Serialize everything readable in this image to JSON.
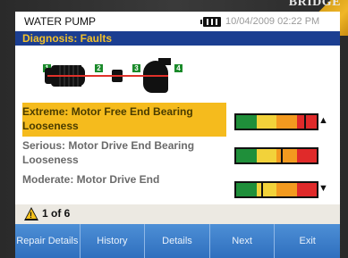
{
  "bezel": {
    "label": "BRIDGE"
  },
  "status_bar": {
    "title": "WATER PUMP",
    "datetime": "10/04/2009 02:22 PM",
    "battery_icon": "battery-icon"
  },
  "header": {
    "title": "Diagnosis: Faults"
  },
  "machine_positions": [
    "1",
    "2",
    "3",
    "4"
  ],
  "faults": [
    {
      "label": "Extreme: Motor Free End Bearing Looseness",
      "severity_marker": 0.88,
      "selected": true,
      "scroll_icon": "▲"
    },
    {
      "label": "Serious: Motor Drive End Bearing Looseness",
      "severity_marker": 0.58,
      "selected": false,
      "scroll_icon": ""
    },
    {
      "label": "Moderate: Motor Drive End",
      "severity_marker": 0.32,
      "selected": false,
      "scroll_icon": "▼"
    }
  ],
  "severity_colors": [
    "#1f8f3a",
    "#f2d23a",
    "#f39a1f",
    "#e02a2a"
  ],
  "footer": {
    "page": "1 of 6",
    "warning_icon": "warning-icon"
  },
  "softkeys": [
    {
      "label": "Repair Details"
    },
    {
      "label": "History"
    },
    {
      "label": "Details"
    },
    {
      "label": "Next"
    },
    {
      "label": "Exit"
    }
  ]
}
